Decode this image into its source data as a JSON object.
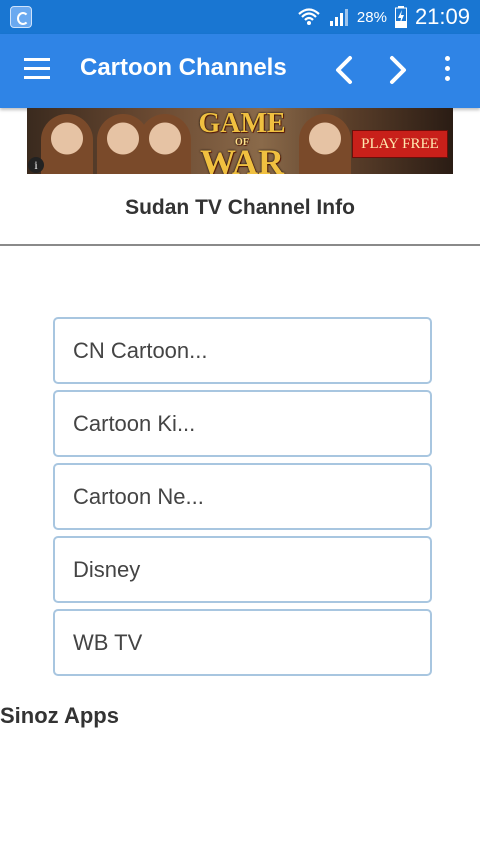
{
  "status_bar": {
    "battery_percent": "28%",
    "time": "21:09",
    "icons": [
      "wifi-icon",
      "signal-icon",
      "battery-charging-icon"
    ]
  },
  "toolbar": {
    "title": "Cartoon Channels",
    "icons": [
      "menu-icon",
      "chevron-left-icon",
      "chevron-right-icon",
      "overflow-menu-icon"
    ]
  },
  "ad": {
    "game_word": "GAME",
    "of_word": "OF",
    "war_word": "WAR",
    "cta": "PLAY FREE",
    "info_icon": "i"
  },
  "page": {
    "heading": "Sudan TV Channel Info"
  },
  "channels": [
    {
      "label": "CN Cartoon..."
    },
    {
      "label": "Cartoon Ki..."
    },
    {
      "label": "Cartoon Ne..."
    },
    {
      "label": "Disney"
    },
    {
      "label": "WB TV"
    }
  ],
  "footer": {
    "text": "Sinoz Apps"
  },
  "colors": {
    "status_bar": "#1976d2",
    "toolbar": "#2f84e6",
    "item_border": "#a8c6e0"
  }
}
